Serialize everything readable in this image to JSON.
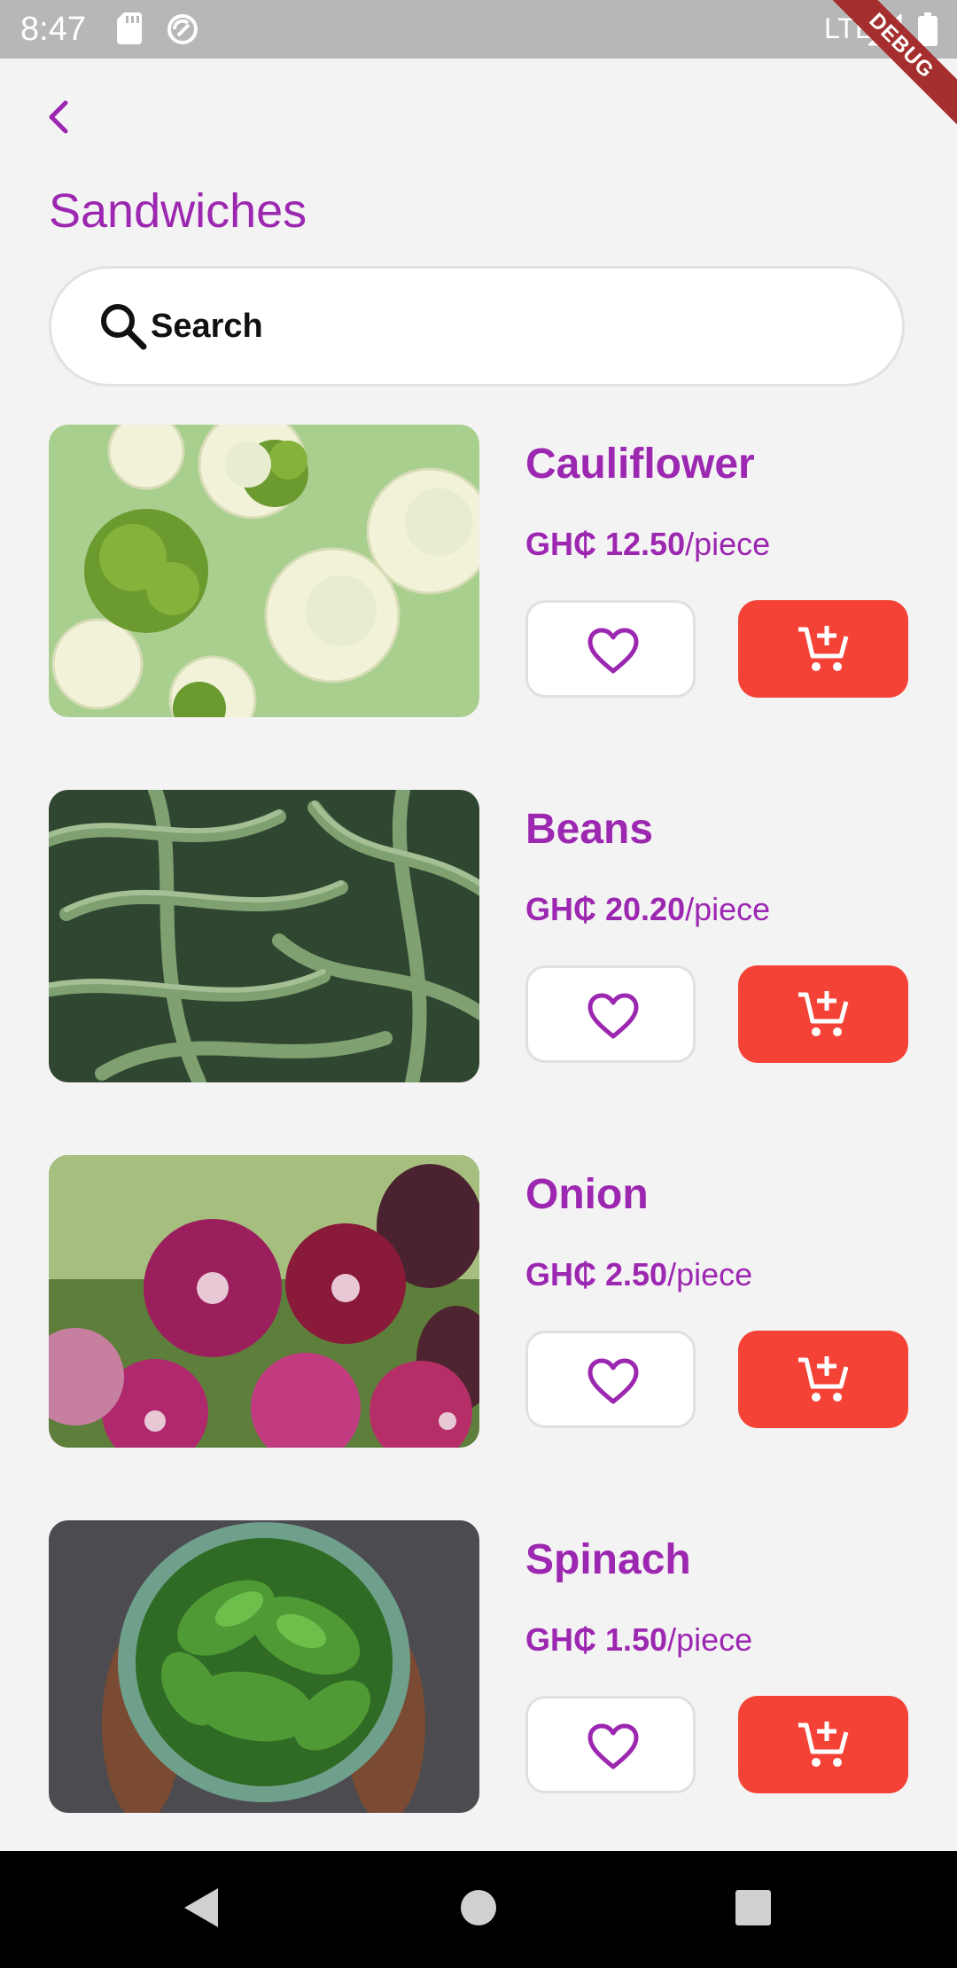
{
  "status_bar": {
    "time": "8:47",
    "network": "LTE",
    "debug_banner": "DEBUG",
    "icons": [
      "sd-card-icon",
      "sync-icon",
      "signal-icon",
      "battery-icon"
    ]
  },
  "header": {
    "back_icon": "chevron-left-icon",
    "title": "Sandwiches"
  },
  "search": {
    "icon": "search-icon",
    "label": "Search"
  },
  "products": [
    {
      "name": "Cauliflower",
      "price": "GH₵ 12.50",
      "unit": "/piece",
      "image": "cauliflower-photo"
    },
    {
      "name": "Beans",
      "price": "GH₵ 20.20",
      "unit": "/piece",
      "image": "green-beans-photo"
    },
    {
      "name": "Onion",
      "price": "GH₵ 2.50",
      "unit": "/piece",
      "image": "red-onion-photo"
    },
    {
      "name": "Spinach",
      "price": "GH₵ 1.50",
      "unit": "/piece",
      "image": "spinach-photo"
    }
  ],
  "product_actions": {
    "favorite_icon": "heart-outline-icon",
    "cart_icon": "add-shopping-cart-icon"
  },
  "nav_bar": {
    "icons": [
      "back-triangle-icon",
      "home-circle-icon",
      "recents-square-icon"
    ]
  },
  "colors": {
    "accent": "#9c27b0",
    "cart_button": "#f44336",
    "background": "#f4f3f4",
    "status_bar": "#b7b7b7"
  }
}
